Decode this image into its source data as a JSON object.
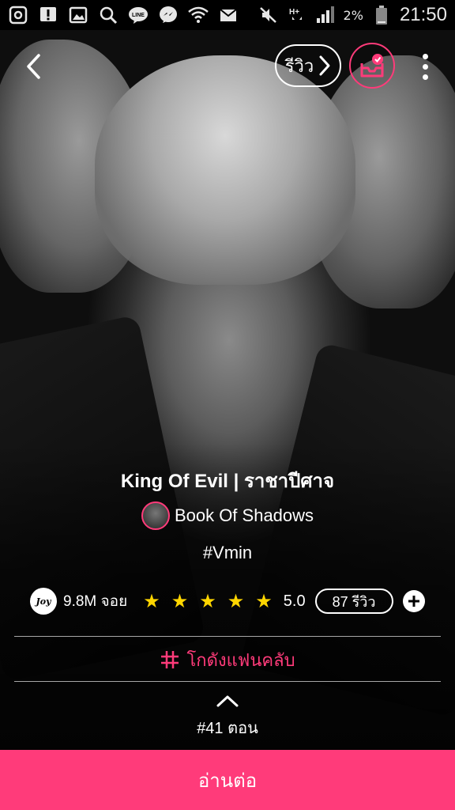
{
  "status_bar": {
    "icons_left": [
      "opera-icon",
      "alert-icon",
      "gallery-icon",
      "search-icon",
      "line-icon",
      "messenger-icon",
      "wifi-icon",
      "mail-icon"
    ],
    "battery": "2%",
    "time": "21:50"
  },
  "nav": {
    "review_label": "รีวิว"
  },
  "story": {
    "title": "King Of Evil | ราชาปีศาจ",
    "author": "Book Of Shadows",
    "tag": "#Vmin",
    "joy_badge": "Joy",
    "views": "9.8M จอย",
    "stars": 5,
    "rating": "5.0",
    "reviews": "87 รีวิว"
  },
  "fanclub_label": "โกดังแฟนคลับ",
  "episode_label": "#41 ตอน",
  "read_button": "อ่านต่อ",
  "colors": {
    "accent": "#ff3b7a",
    "star": "#ffd600"
  }
}
